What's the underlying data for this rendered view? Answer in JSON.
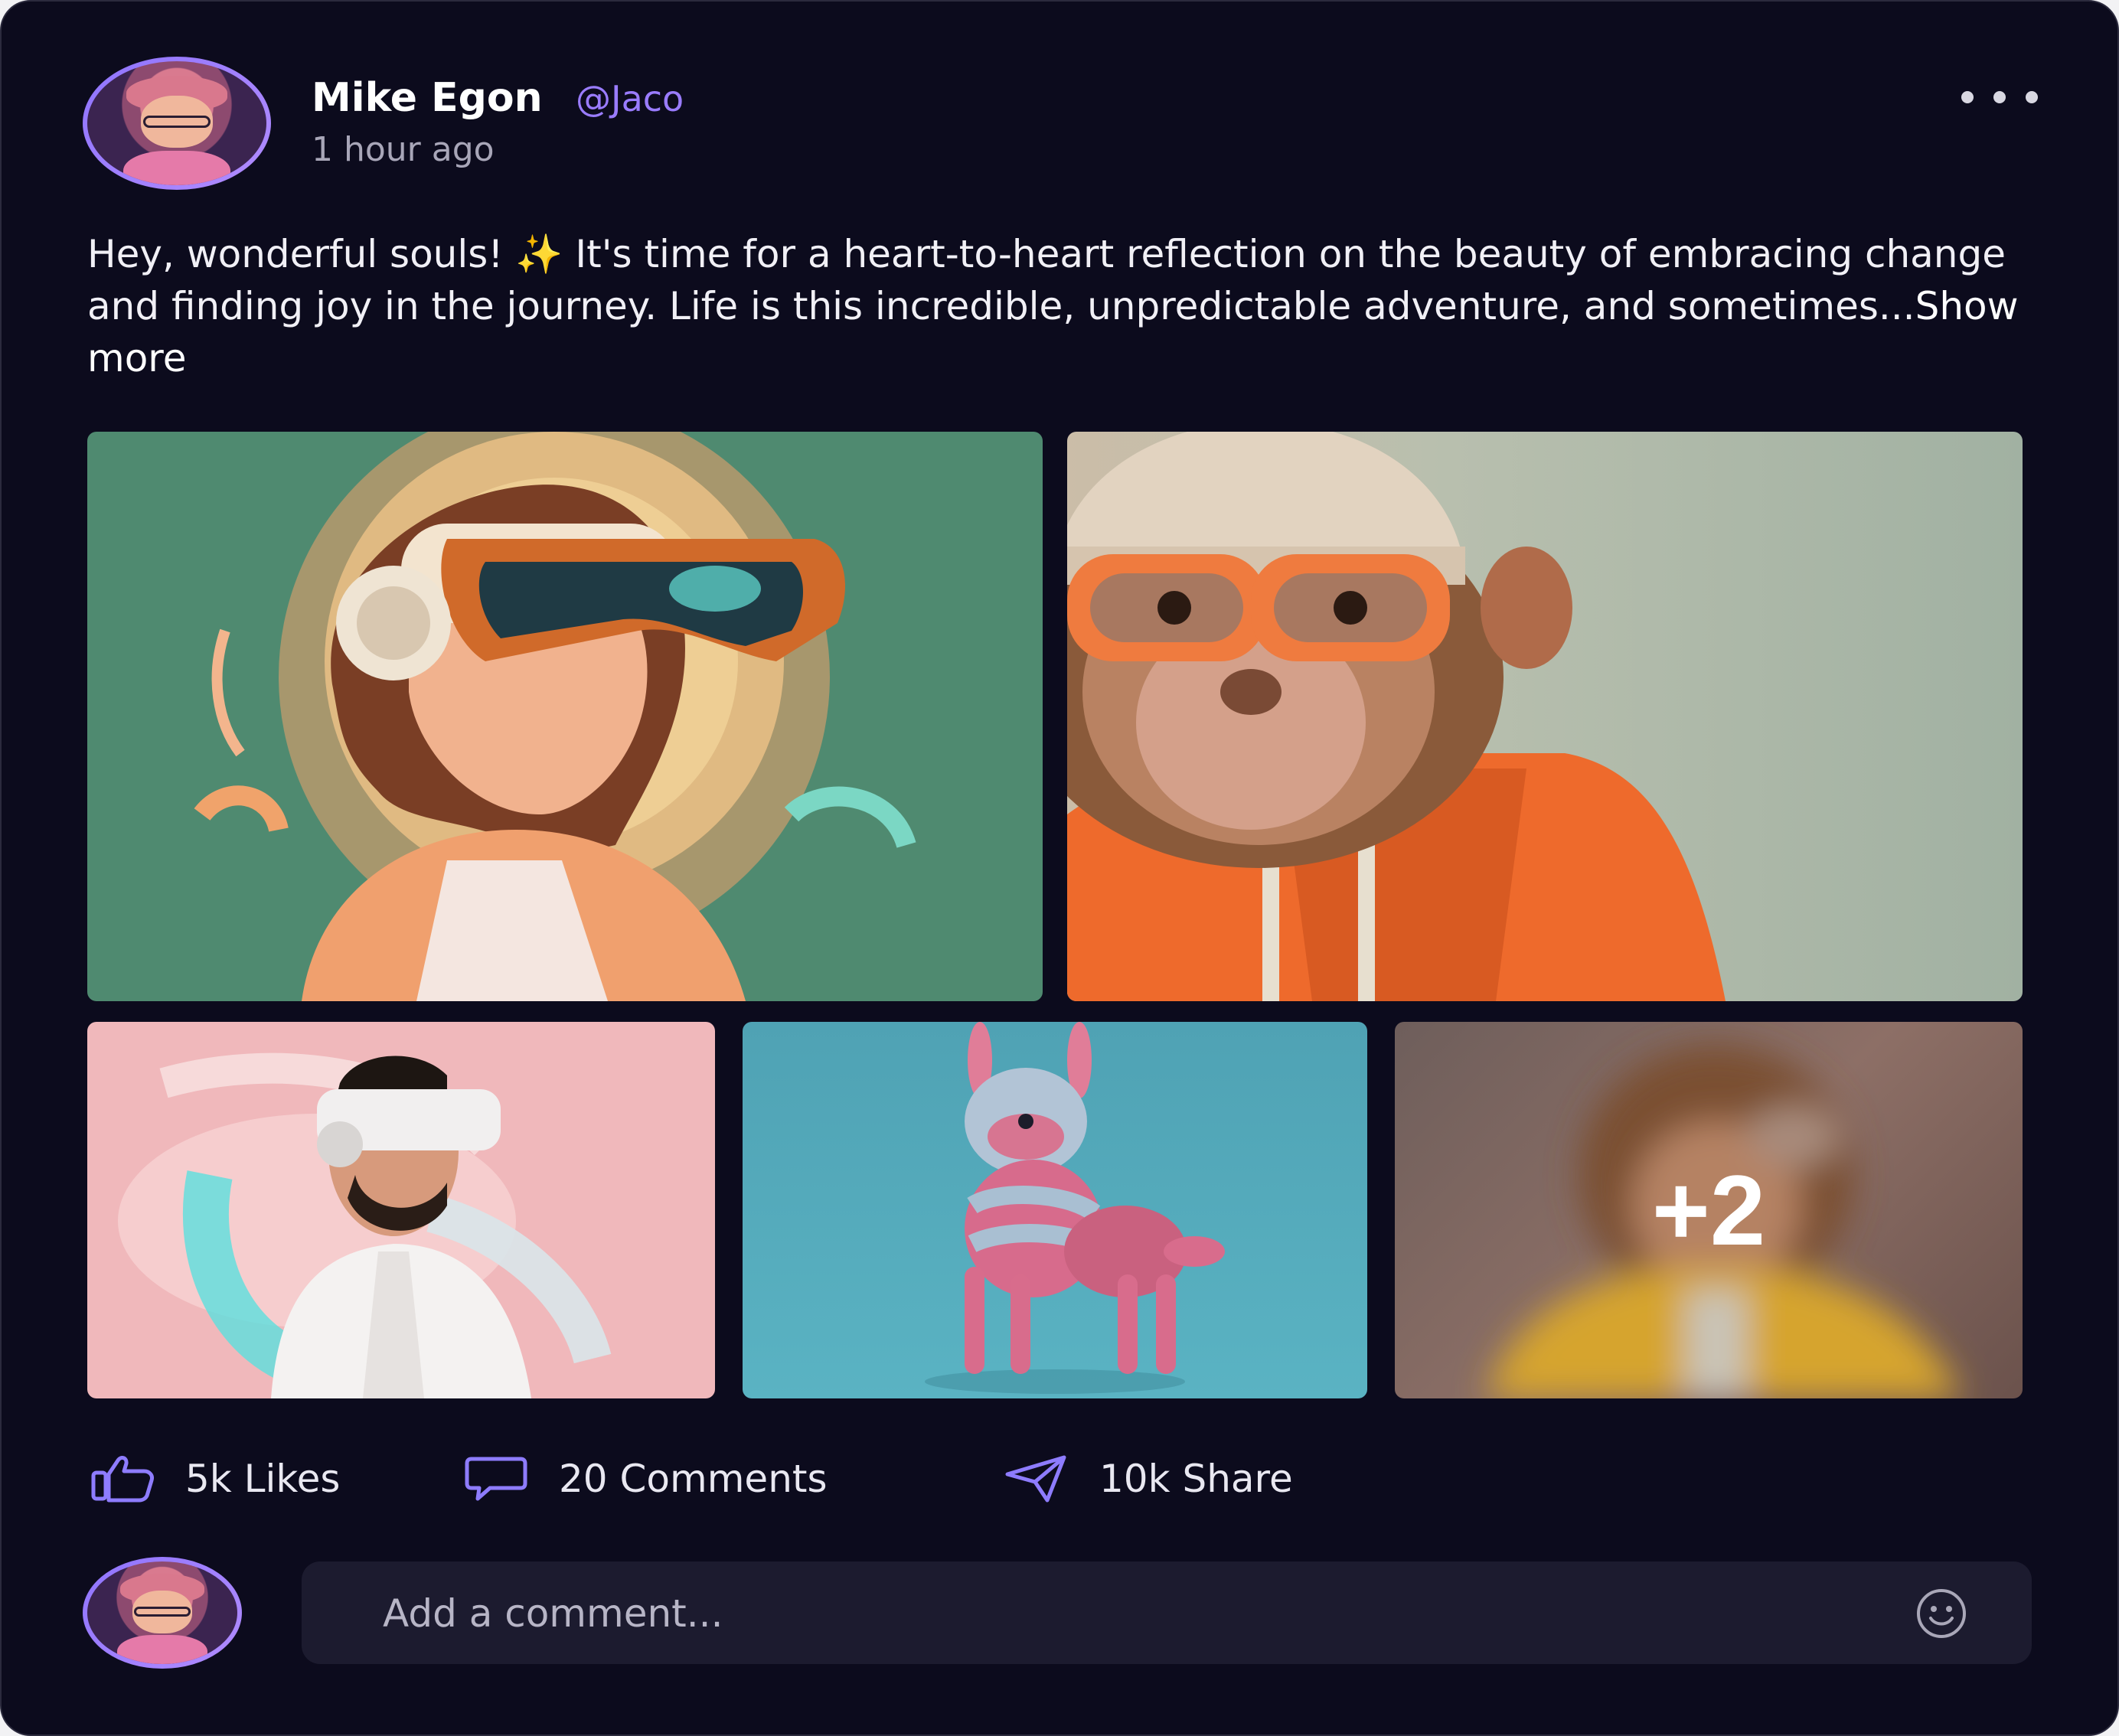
{
  "post": {
    "author_name": "Mike Egon",
    "author_handle": "@Jaco",
    "timestamp": "1 hour ago",
    "text": "Hey, wonderful souls! ✨ It's time for a heart-to-heart reflection on the beauty of embracing change and finding joy in the journey. Life is this incredible, unpredictable adventure, and sometimes...",
    "show_more_label": "Show more",
    "extra_images_label": "+2"
  },
  "stats": {
    "likes_label": "5k Likes",
    "comments_label": "20 Comments",
    "share_label": "10k Share"
  },
  "comment": {
    "placeholder": "Add a comment..."
  },
  "icons": {
    "menu": "more-horizontal-icon",
    "like": "thumbs-up-icon",
    "comment": "chat-bubble-icon",
    "share": "send-icon",
    "emoji": "smiley-icon"
  },
  "colors": {
    "background": "#0c0b1d",
    "accent": "#9a7cff",
    "input_background": "#1c1b2f"
  }
}
